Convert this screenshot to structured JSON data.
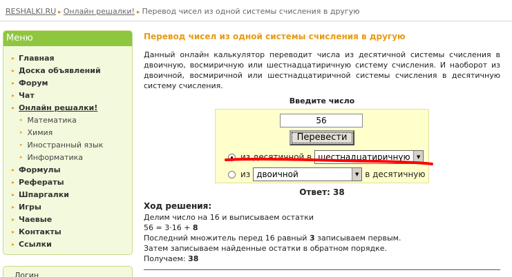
{
  "breadcrumb": {
    "site": "RESHALKI.RU",
    "section": "Онлайн решалки!",
    "current": "Перевод чисел из одной системы счисления в другую"
  },
  "sidebar": {
    "title": "Меню",
    "items": [
      {
        "label": "Главная"
      },
      {
        "label": "Доска объявлений"
      },
      {
        "label": "Форум"
      },
      {
        "label": "Чат"
      },
      {
        "label": "Онлайн решалки!"
      },
      {
        "label": "Математика"
      },
      {
        "label": "Химия"
      },
      {
        "label": "Иностранный язык"
      },
      {
        "label": "Информатика"
      },
      {
        "label": "Формулы"
      },
      {
        "label": "Рефераты"
      },
      {
        "label": "Шпаргалки"
      },
      {
        "label": "Игры"
      },
      {
        "label": "Чаевые"
      },
      {
        "label": "Контакты"
      },
      {
        "label": "Ссылки"
      }
    ],
    "login_title": "Логин"
  },
  "main": {
    "title": "Перевод чисел из одной системы счисления в другую",
    "description": "Данный онлайн калькулятор переводит числа из десятичной системы счисления в двоичную, восмиричную или шестнадцатиричную систему счисления. И наоборот из двоичной, восмиричной или шестнадцатиричной системы счисления в десятичную систему счисления."
  },
  "form": {
    "title": "Введите число",
    "input_value": "56",
    "button_label": "Перевести",
    "option1": {
      "prefix": "из десятичной в",
      "selected": "шестнадцатиричную",
      "checked": true
    },
    "option2": {
      "prefix": "из",
      "selected": "двоичной",
      "suffix": "в десятичную",
      "checked": false
    }
  },
  "answer": "Ответ: 38",
  "solution": {
    "title": "Ход решения:",
    "line1": "Делим число на 16 и выписываем остатки",
    "line2_pre": "56 = 3·16 + ",
    "line2_bold": "8",
    "line3_pre": "Последний множитель перед 16 равный ",
    "line3_bold": "3",
    "line3_post": " записываем первым.",
    "line4": "Затем записываем найденные остатки в обратном порядке.",
    "line5_pre": "Получаем: ",
    "line5_bold": "38"
  },
  "colors": {
    "accent": "#e89a14",
    "menu_header": "#8ec63f",
    "menu_bg": "#f3f9dc",
    "form_bg": "#ffffcc",
    "annotation": "#ff0000"
  }
}
